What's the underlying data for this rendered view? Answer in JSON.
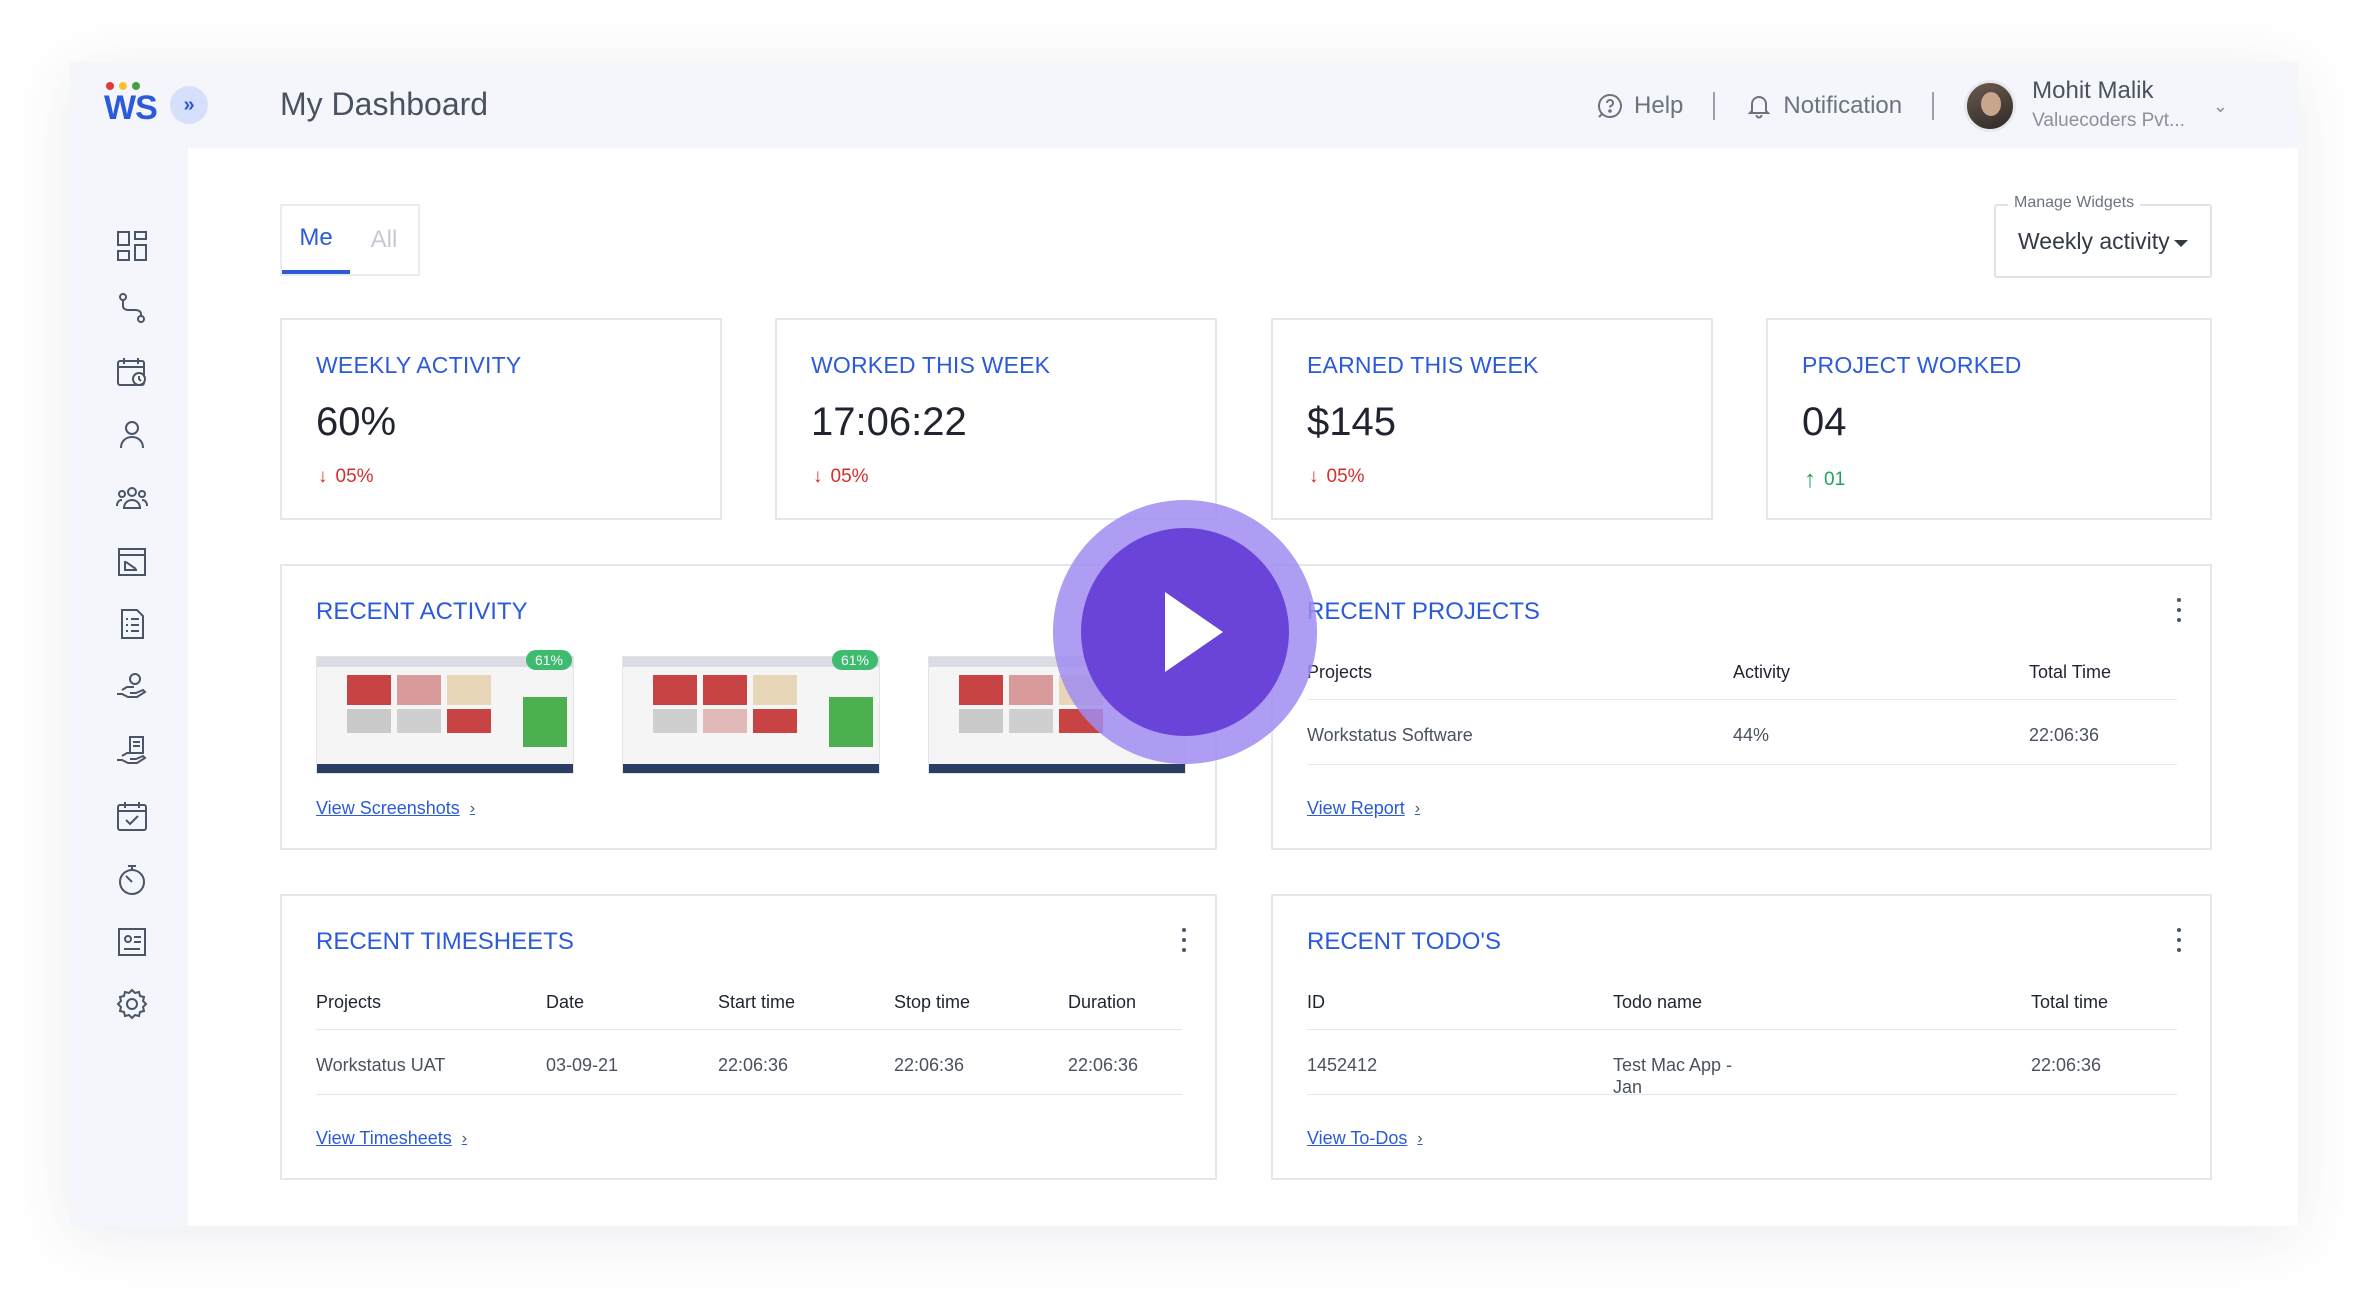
{
  "app": {
    "logo_text": "WS",
    "logo_dot_colors": [
      "#e53935",
      "#fbc02d",
      "#43a047"
    ],
    "page_title": "My Dashboard"
  },
  "header": {
    "help_label": "Help",
    "notification_label": "Notification",
    "user_name": "Mohit Malik",
    "user_org": "Valuecoders Pvt..."
  },
  "sidebar": {
    "icons": [
      "dashboard-icon",
      "route-icon",
      "calendar-clock-icon",
      "user-icon",
      "team-icon",
      "browser-chart-icon",
      "report-list-icon",
      "hand-coin-icon",
      "hand-invoice-icon",
      "calendar-check-icon",
      "timer-icon",
      "id-card-icon",
      "settings-icon"
    ]
  },
  "tabs": {
    "me": "Me",
    "all": "All"
  },
  "manage_widgets": {
    "label": "Manage Widgets",
    "value": "Weekly activity"
  },
  "stats": [
    {
      "title": "WEEKLY ACTIVITY",
      "value": "60%",
      "change": "05%",
      "direction": "down"
    },
    {
      "title": "WORKED THIS WEEK",
      "value": "17:06:22",
      "change": "05%",
      "direction": "down"
    },
    {
      "title": "EARNED THIS WEEK",
      "value": "$145",
      "change": "05%",
      "direction": "down"
    },
    {
      "title": "PROJECT WORKED",
      "value": "04",
      "change": "01",
      "direction": "up"
    }
  ],
  "recent_activity": {
    "title": "RECENT ACTIVITY",
    "screenshots": [
      {
        "badge": "61%"
      },
      {
        "badge": "61%"
      },
      {
        "badge": ""
      }
    ],
    "link": "View Screenshots"
  },
  "recent_projects": {
    "title": "RECENT PROJECTS",
    "headers": [
      "Projects",
      "Activity",
      "Total Time"
    ],
    "rows": [
      [
        "Workstatus Software",
        "44%",
        "22:06:36"
      ]
    ],
    "link": "View Report"
  },
  "recent_timesheets": {
    "title": "RECENT TIMESHEETS",
    "headers": [
      "Projects",
      "Date",
      "Start time",
      "Stop time",
      "Duration"
    ],
    "rows": [
      [
        "Workstatus UAT",
        "03-09-21",
        "22:06:36",
        "22:06:36",
        "22:06:36"
      ]
    ],
    "link": "View Timesheets"
  },
  "recent_todos": {
    "title": "RECENT TODO'S",
    "headers": [
      "ID",
      "Todo name",
      "Total time"
    ],
    "rows": [
      [
        "1452412",
        "Test Mac App -\nJan",
        "22:06:36"
      ]
    ],
    "link": "View To-Dos"
  },
  "colors": {
    "accent": "#2c5bd9",
    "down": "#d62d2d",
    "up": "#22a35a",
    "play": "#6a44d8"
  }
}
